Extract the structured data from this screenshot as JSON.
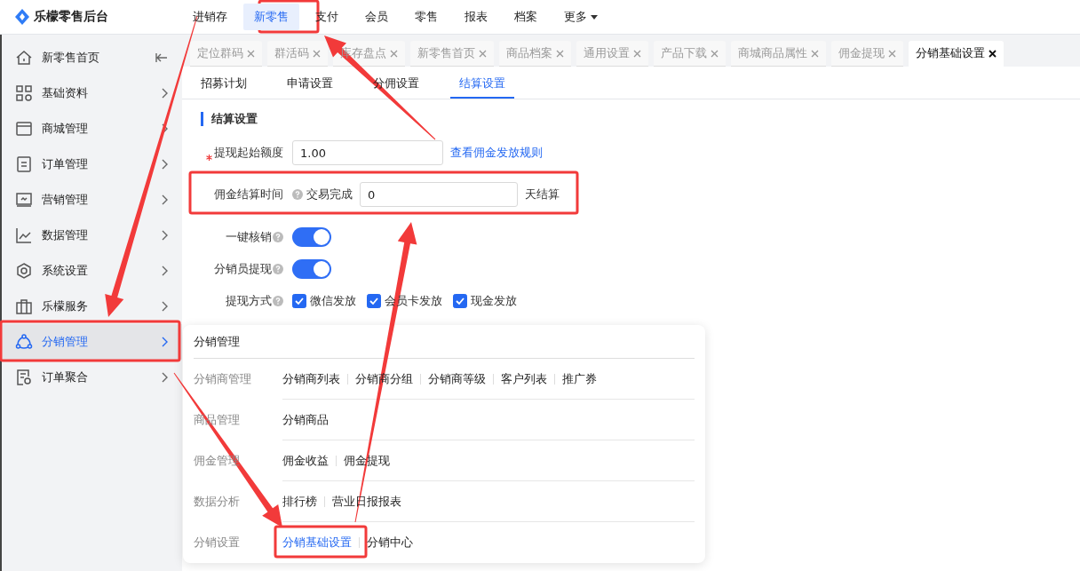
{
  "app": {
    "title": "乐檬零售后台"
  },
  "top_nav": [
    {
      "label": "进销存",
      "selected": false,
      "dropdown": false
    },
    {
      "label": "新零售",
      "selected": true,
      "dropdown": false
    },
    {
      "label": "支付",
      "selected": false,
      "dropdown": false
    },
    {
      "label": "会员",
      "selected": false,
      "dropdown": false
    },
    {
      "label": "零售",
      "selected": false,
      "dropdown": false
    },
    {
      "label": "报表",
      "selected": false,
      "dropdown": false
    },
    {
      "label": "档案",
      "selected": false,
      "dropdown": false
    },
    {
      "label": "更多",
      "selected": false,
      "dropdown": true
    }
  ],
  "sidebar": {
    "items": [
      {
        "label": "新零售首页",
        "kind": "home",
        "selected": false
      },
      {
        "label": "基础资料",
        "kind": "group",
        "selected": false
      },
      {
        "label": "商城管理",
        "kind": "group",
        "selected": false
      },
      {
        "label": "订单管理",
        "kind": "group",
        "selected": false
      },
      {
        "label": "营销管理",
        "kind": "group",
        "selected": false
      },
      {
        "label": "数据管理",
        "kind": "group",
        "selected": false
      },
      {
        "label": "系统设置",
        "kind": "group",
        "selected": false
      },
      {
        "label": "乐檬服务",
        "kind": "group",
        "selected": false
      },
      {
        "label": "分销管理",
        "kind": "group",
        "selected": true
      },
      {
        "label": "订单聚合",
        "kind": "group",
        "selected": false
      }
    ]
  },
  "page_tabs": [
    {
      "label": "定位群码",
      "selected": false
    },
    {
      "label": "群活码",
      "selected": false
    },
    {
      "label": "库存盘点",
      "selected": false
    },
    {
      "label": "新零售首页",
      "selected": false
    },
    {
      "label": "商品档案",
      "selected": false
    },
    {
      "label": "通用设置",
      "selected": false
    },
    {
      "label": "产品下载",
      "selected": false
    },
    {
      "label": "商城商品属性",
      "selected": false
    },
    {
      "label": "佣金提现",
      "selected": false
    },
    {
      "label": "分销基础设置",
      "selected": true
    }
  ],
  "sub_tabs": [
    {
      "label": "招募计划",
      "selected": false
    },
    {
      "label": "申请设置",
      "selected": false
    },
    {
      "label": "分佣设置",
      "selected": false
    },
    {
      "label": "结算设置",
      "selected": true
    }
  ],
  "section_title": "结算设置",
  "withdraw_minimum": {
    "label": "提现起始额度",
    "required": true,
    "value": "1.00",
    "link": "查看佣金发放规则"
  },
  "settlement_time": {
    "label": "佣金结算时间",
    "prefix": "交易完成",
    "value": "0",
    "suffix": "天结算"
  },
  "toggles": [
    {
      "label": "一键核销",
      "on": true
    },
    {
      "label": "分销员提现",
      "on": true
    }
  ],
  "withdraw_methods": {
    "label": "提现方式",
    "options": [
      {
        "label": "微信发放",
        "checked": true
      },
      {
        "label": "会员卡发放",
        "checked": true
      },
      {
        "label": "现金发放",
        "checked": true
      }
    ]
  },
  "popup_menu": {
    "title": "分销管理",
    "groups": [
      {
        "label": "分销商管理",
        "links": [
          {
            "label": "分销商列表",
            "selected": false
          },
          {
            "label": "分销商分组",
            "selected": false
          },
          {
            "label": "分销商等级",
            "selected": false
          },
          {
            "label": "客户列表",
            "selected": false
          },
          {
            "label": "推广券",
            "selected": false
          }
        ]
      },
      {
        "label": "商品管理",
        "links": [
          {
            "label": "分销商品",
            "selected": false
          }
        ]
      },
      {
        "label": "佣金管理",
        "links": [
          {
            "label": "佣金收益",
            "selected": false
          },
          {
            "label": "佣金提现",
            "selected": false
          }
        ]
      },
      {
        "label": "数据分析",
        "links": [
          {
            "label": "排行榜",
            "selected": false
          },
          {
            "label": "营业日报报表",
            "selected": false
          }
        ]
      },
      {
        "label": "分销设置",
        "links": [
          {
            "label": "分销基础设置",
            "selected": true
          },
          {
            "label": "分销中心",
            "selected": false
          }
        ]
      }
    ]
  }
}
